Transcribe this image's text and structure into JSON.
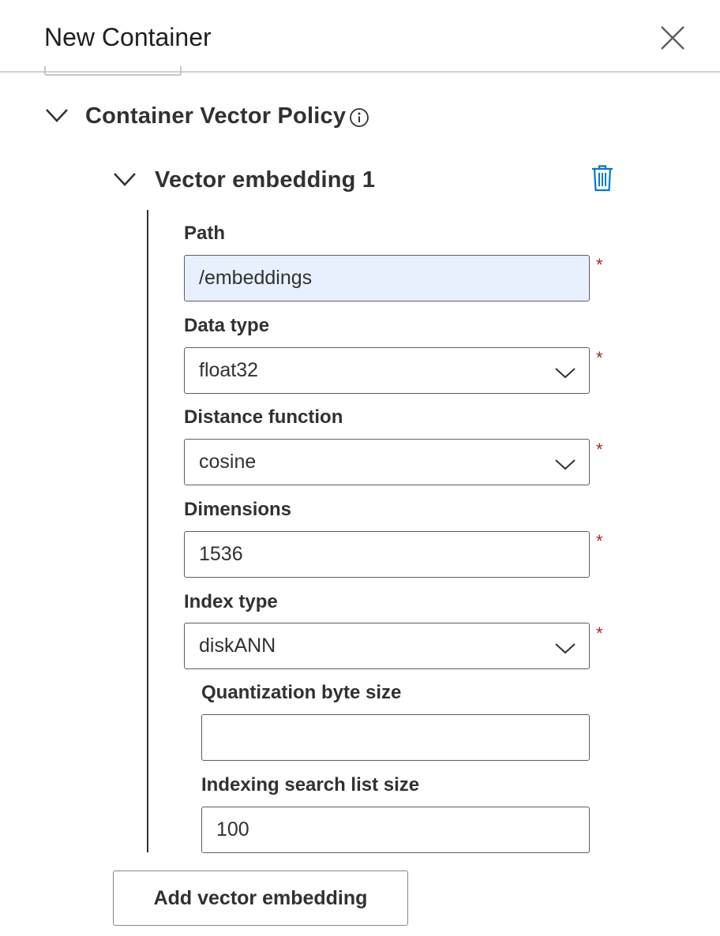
{
  "header": {
    "title": "New Container"
  },
  "section": {
    "title": "Container Vector Policy"
  },
  "embedding": {
    "title": "Vector embedding 1",
    "fields": {
      "path": {
        "label": "Path",
        "value": "/embeddings",
        "required": "*"
      },
      "data_type": {
        "label": "Data type",
        "value": "float32",
        "required": "*"
      },
      "distance_function": {
        "label": "Distance function",
        "value": "cosine",
        "required": "*"
      },
      "dimensions": {
        "label": "Dimensions",
        "value": "1536",
        "required": "*"
      },
      "index_type": {
        "label": "Index type",
        "value": "diskANN",
        "required": "*"
      },
      "quantization_byte_size": {
        "label": "Quantization byte size",
        "value": ""
      },
      "indexing_search_list_size": {
        "label": "Indexing search list size",
        "value": "100"
      }
    }
  },
  "add_button": {
    "label": "Add vector embedding"
  },
  "icons": {
    "close": "close-icon",
    "section_chevron": "chevron-down-icon",
    "info": "info-icon",
    "embedding_chevron": "chevron-down-icon",
    "delete": "trash-icon",
    "select_caret": "chevron-down-icon"
  },
  "colors": {
    "accent": "#0078d4",
    "required": "#a4262c",
    "autofill_bg": "#e8f0fe",
    "text": "#323130"
  }
}
